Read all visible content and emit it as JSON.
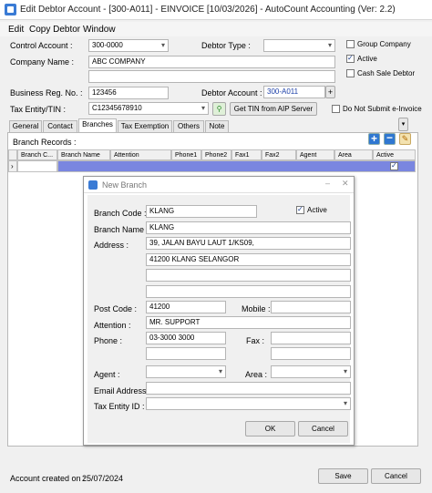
{
  "window": {
    "title": "Edit Debtor Account - [300-A011] - EINVOICE [10/03/2026] - AutoCount Accounting (Ver: 2.2)"
  },
  "menu": {
    "items": [
      "Edit",
      "Copy Debtor",
      "Window"
    ]
  },
  "form": {
    "control_account_label": "Control Account :",
    "control_account_value": "300-0000",
    "debtor_type_label": "Debtor Type :",
    "debtor_type_value": "",
    "group_company_label": "Group Company",
    "group_company_checked": false,
    "active_label": "Active",
    "active_checked": true,
    "cash_sale_label": "Cash Sale Debtor",
    "cash_sale_checked": false,
    "company_name_label": "Company Name :",
    "company_name_value": "ABC COMPANY",
    "company_name_line2": "",
    "business_reg_label": "Business Reg. No. :",
    "business_reg_value": "123456",
    "debtor_account_label": "Debtor Account :",
    "debtor_account_value": "300-A011",
    "tax_entity_label": "Tax Entity/TIN :",
    "tax_entity_value": "C12345678910",
    "get_tin_label": "Get TIN from AIP Server",
    "no_einvoice_label": "Do Not Submit e-Invoice",
    "no_einvoice_checked": false
  },
  "tabs": [
    "General",
    "Contact",
    "Branches",
    "Tax Exemption",
    "Others",
    "Note"
  ],
  "active_tab": "Branches",
  "branch_records": {
    "label": "Branch Records :",
    "columns": [
      "Branch C...",
      "Branch Name",
      "Attention",
      "Phone1",
      "Phone2",
      "Fax1",
      "Fax2",
      "Agent",
      "Area",
      "Active"
    ],
    "row_marker": "›"
  },
  "dialog": {
    "title": "New Branch",
    "branch_code_label": "Branch Code :",
    "branch_code_value": "KLANG",
    "active_label": "Active",
    "active_checked": true,
    "branch_name_label": "Branch Name :",
    "branch_name_value": "KLANG",
    "address_label": "Address :",
    "address_lines": [
      "39, JALAN BAYU LAUT 1/KS09,",
      "41200 KLANG SELANGOR",
      "",
      ""
    ],
    "post_code_label": "Post Code :",
    "post_code_value": "41200",
    "mobile_label": "Mobile :",
    "mobile_value": "",
    "attention_label": "Attention :",
    "attention_value": "MR. SUPPORT",
    "phone_label": "Phone :",
    "phone_value": "03-3000 3000",
    "phone2_value": "",
    "fax_label": "Fax :",
    "fax_value": "",
    "fax2_value": "",
    "agent_label": "Agent :",
    "agent_value": "",
    "area_label": "Area :",
    "area_value": "",
    "email_label": "Email Address :",
    "email_value": "",
    "tax_entity_label": "Tax Entity ID :",
    "tax_entity_value": "",
    "ok_label": "OK",
    "cancel_label": "Cancel"
  },
  "footer": {
    "created_label": "Account created on :",
    "created_value": "25/07/2024",
    "save_label": "Save",
    "cancel_label": "Cancel"
  },
  "colors": {
    "accent": "#3a7bd5",
    "selected_row": "#7a86e0"
  }
}
